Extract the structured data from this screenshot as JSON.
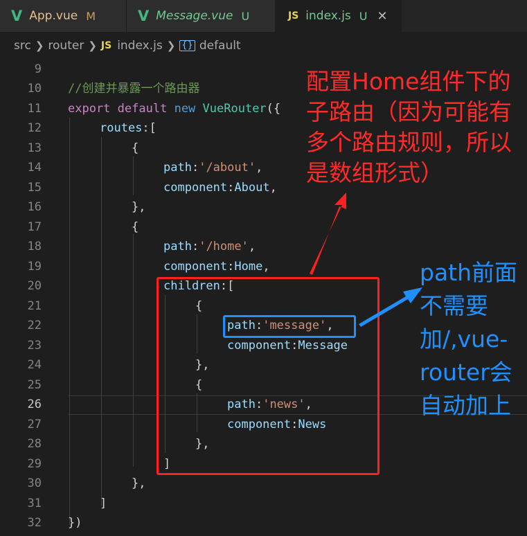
{
  "tabs": [
    {
      "icon": "V",
      "label": "App.vue",
      "badge": "M"
    },
    {
      "icon": "V",
      "label": "Message.vue",
      "badge": "U"
    },
    {
      "icon": "JS",
      "label": "index.js",
      "badge": "U",
      "close": "✕"
    }
  ],
  "breadcrumb": {
    "parts": [
      "src",
      "router",
      "index.js",
      "default"
    ],
    "js_icon": "JS",
    "symbol_icon": "{}"
  },
  "line_numbers": [
    "9",
    "10",
    "11",
    "12",
    "13",
    "14",
    "15",
    "16",
    "17",
    "18",
    "19",
    "20",
    "21",
    "22",
    "23",
    "24",
    "25",
    "26",
    "27",
    "28",
    "29",
    "30",
    "31",
    "32"
  ],
  "current_line": "26",
  "code": {
    "l10_comment": "//创建并暴露一个路由器",
    "l11_export": "export",
    "l11_default": "default",
    "l11_new": "new",
    "l11_class": "VueRouter",
    "l11_open": "({",
    "l12_routes": "routes",
    "l12_open": ":[",
    "brace_open": "{",
    "brace_close_comma": "},",
    "brace_close": "}",
    "path_key": "path",
    "component_key": "component",
    "colon": ":",
    "comma": ",",
    "l14_path": "'/about'",
    "l15_component": "About",
    "l18_path": "'/home'",
    "l19_component": "Home",
    "l20_children": "children",
    "l20_open": ":[",
    "l22_path": "'message'",
    "l23_component": "Message",
    "l26_path": "'news'",
    "l27_component": "News",
    "l29_close": "]",
    "l31_close": "]",
    "l32_close": "})"
  },
  "annotations": {
    "red_note": "配置Home组件下的子路由（因为可能有多个路由规则，所以是数组形式）",
    "blue_note": "path前面不需要加/,vue-router会自动加上"
  },
  "colors": {
    "red": "#ff2a2a",
    "blue": "#1e90ff",
    "vue_green": "#41b883",
    "js_yellow": "#e8d44d"
  }
}
